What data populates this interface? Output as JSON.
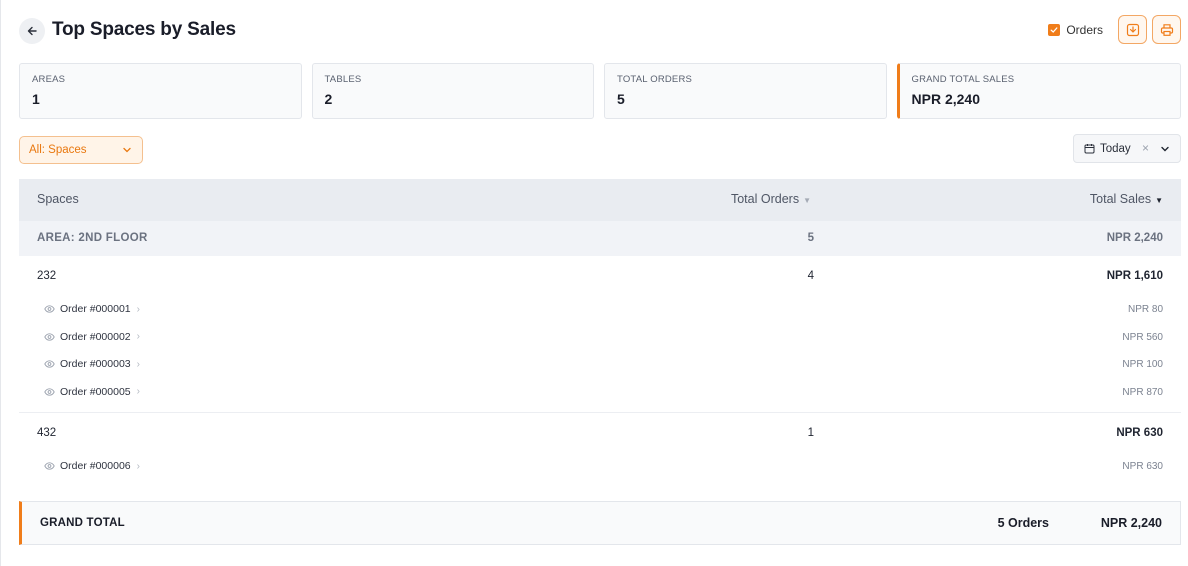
{
  "header": {
    "title": "Top Spaces by Sales",
    "orders_toggle_label": "Orders",
    "orders_toggle_checked": true
  },
  "stats": [
    {
      "label": "AREAS",
      "value": "1"
    },
    {
      "label": "TABLES",
      "value": "2"
    },
    {
      "label": "TOTAL ORDERS",
      "value": "5"
    },
    {
      "label": "GRAND TOTAL SALES",
      "value": "NPR 2,240"
    }
  ],
  "filters": {
    "space_filter": "All: Spaces",
    "date_filter": "Today",
    "clear_glyph": "×"
  },
  "table": {
    "columns": {
      "spaces": "Spaces",
      "total_orders": "Total Orders",
      "total_sales": "Total Sales"
    },
    "area": {
      "name": "AREA: 2ND FLOOR",
      "orders": "5",
      "sales": "NPR 2,240"
    },
    "rows": [
      {
        "name": "232",
        "orders": "4",
        "sales": "NPR 1,610",
        "orders_list": [
          {
            "label": "Order #000001",
            "sales": "NPR 80"
          },
          {
            "label": "Order #000002",
            "sales": "NPR 560"
          },
          {
            "label": "Order #000003",
            "sales": "NPR 100"
          },
          {
            "label": "Order #000005",
            "sales": "NPR 870"
          }
        ]
      },
      {
        "name": "432",
        "orders": "1",
        "sales": "NPR 630",
        "orders_list": [
          {
            "label": "Order #000006",
            "sales": "NPR 630"
          }
        ]
      }
    ]
  },
  "grand_total": {
    "label": "GRAND TOTAL",
    "orders": "5 Orders",
    "sales": "NPR 2,240"
  },
  "colors": {
    "accent": "#f07d1a",
    "header_bg": "#e9ecf1",
    "area_bg": "#f1f3f7"
  },
  "icons": {
    "back": "arrow-left-icon",
    "download": "download-icon",
    "print": "printer-icon",
    "calendar": "calendar-icon",
    "view": "eye-icon"
  }
}
